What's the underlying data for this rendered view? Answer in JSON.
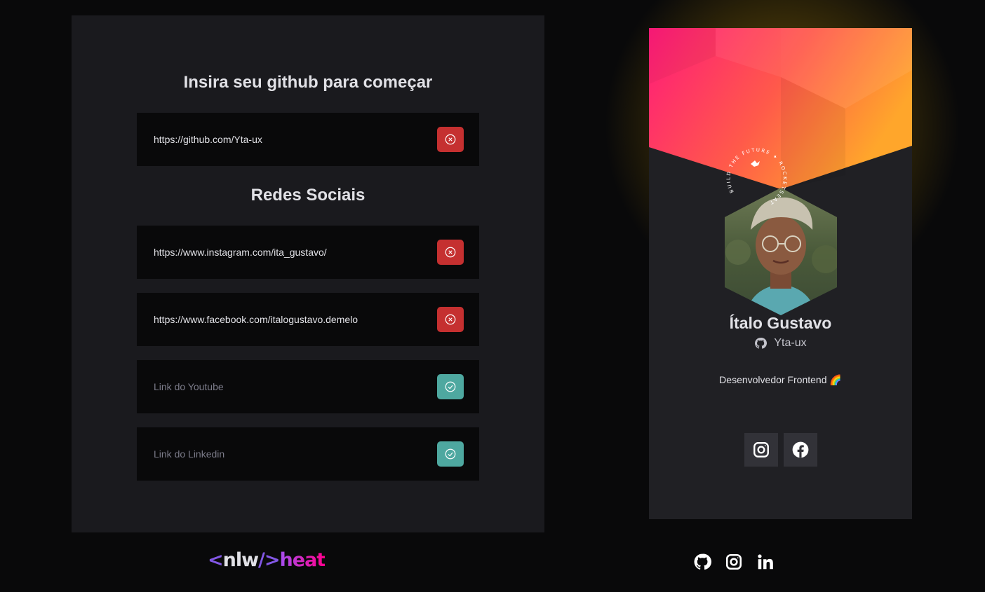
{
  "form": {
    "title": "Insira seu github para começar",
    "github_value": "https://github.com/Yta-ux",
    "social_title": "Redes Sociais",
    "instagram_value": "https://www.instagram.com/ita_gustavo/",
    "facebook_value": "https://www.facebook.com/italogustavo.demelo",
    "youtube_placeholder": "Link do Youtube",
    "linkedin_placeholder": "Link do Linkedin"
  },
  "profile": {
    "name": "Ítalo Gustavo",
    "username": "Yta-ux",
    "bio": "Desenvolvedor Frontend 🌈",
    "avatar_ring_text": "BUILD THE FUTURE ✦ ROCKETSEAT ✦"
  },
  "footer": {
    "logo_bracket_open": "<",
    "logo_nlw": "nlw",
    "logo_slash": "/>",
    "logo_heat": "heat"
  },
  "icons": {
    "error_status": "x-circle-icon",
    "ok_status": "check-circle-icon",
    "github": "github-icon",
    "instagram": "instagram-icon",
    "facebook": "facebook-icon",
    "linkedin": "linkedin-icon"
  },
  "colors": {
    "error": "#c53030",
    "success": "#4ea8a0",
    "brand_purple": "#8257e5",
    "brand_pink": "#ff008e"
  }
}
